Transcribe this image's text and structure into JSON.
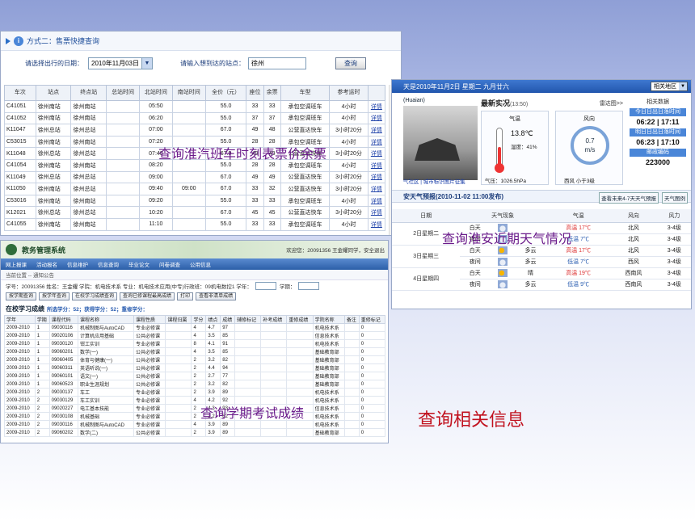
{
  "bus": {
    "header": "方式二：售票快捷查询",
    "date_label": "请选择出行的日期：",
    "date_value": "2010年11月03日",
    "station_label": "请输入想到达的站点：",
    "station_value": "徐州",
    "query_button": "查询",
    "columns": [
      "车次",
      "站点",
      "终点站",
      "总站时间",
      "北站时间",
      "南站时间",
      "全价（元）",
      "座位",
      "余票",
      "车型",
      "参考运时",
      ""
    ],
    "rows": [
      [
        "C41051",
        "徐州南站",
        "徐州南站",
        "",
        "05:50",
        "",
        "55.0",
        "33",
        "33",
        "承包空调班车",
        "4小时",
        "详情"
      ],
      [
        "C41052",
        "徐州南站",
        "徐州南站",
        "",
        "06:20",
        "",
        "55.0",
        "37",
        "37",
        "承包空调班车",
        "4小时",
        "详情"
      ],
      [
        "K11047",
        "徐州总站",
        "徐州总站",
        "",
        "07:00",
        "",
        "67.0",
        "49",
        "48",
        "公营直达快车",
        "3小时20分",
        "详情"
      ],
      [
        "C53015",
        "徐州南站",
        "徐州南站",
        "",
        "07:20",
        "",
        "55.0",
        "28",
        "28",
        "承包空调班车",
        "4小时",
        "详情"
      ],
      [
        "K11048",
        "徐州总站",
        "徐州总站",
        "",
        "07:40",
        "",
        "67.0",
        "49",
        "49",
        "公营直达快车",
        "3小时20分",
        "详情"
      ],
      [
        "C41054",
        "徐州南站",
        "徐州南站",
        "",
        "08:20",
        "",
        "55.0",
        "28",
        "28",
        "承包空调班车",
        "4小时",
        "详情"
      ],
      [
        "K11049",
        "徐州总站",
        "徐州总站",
        "",
        "09:00",
        "",
        "67.0",
        "49",
        "49",
        "公营直达快车",
        "3小时20分",
        "详情"
      ],
      [
        "K11050",
        "徐州南站",
        "徐州总站",
        "",
        "09:40",
        "09:00",
        "67.0",
        "33",
        "32",
        "公营直达快车",
        "3小时20分",
        "详情"
      ],
      [
        "C53016",
        "徐州南站",
        "徐州南站",
        "",
        "09:20",
        "",
        "55.0",
        "33",
        "33",
        "承包空调班车",
        "4小时",
        "详情"
      ],
      [
        "K12021",
        "徐州总站",
        "徐州总站",
        "",
        "10:20",
        "",
        "67.0",
        "45",
        "45",
        "公营直达快车",
        "3小时20分",
        "详情"
      ],
      [
        "C41055",
        "徐州南站",
        "徐州南站",
        "",
        "11:10",
        "",
        "55.0",
        "33",
        "33",
        "承包空调班车",
        "4小时",
        "详情"
      ]
    ]
  },
  "weather": {
    "date_bar": "天是2010年11月2日 星期二 九月廿六",
    "region_select": "相关地区",
    "city": "(Huaian)",
    "links": "气社区 | 城市标识图片征集",
    "now_title": "最新实况",
    "now_time": "(13:50)",
    "radar": "雷达图>>",
    "temp_label": "气温",
    "temp_value": "13.8℃",
    "humidity": "湿度：41%",
    "pressure": "气压：1026.5hPa",
    "wind_label": "风向",
    "wind_speed": "0.7",
    "wind_unit": "m/s",
    "wind_dir": "西风 小于3级",
    "rel_title": "相关数据",
    "sunrise_label": "今日日出日落时间",
    "sunrise": "06:22 | 17:11",
    "sunrise2_label": "明日日出日落时间",
    "sunrise2": "06:23 | 17:10",
    "zip_label": "邮政编码",
    "zip": "223000",
    "forecast_title": "安天气预报(2010-11-02 11:00发布)",
    "btn_more": "查看未来4-7天天气预报",
    "btn_map": "天气图例",
    "columns": [
      "日期",
      "天气现象",
      "气温",
      "风向",
      "风力"
    ],
    "rows": [
      {
        "day": "2日星期二",
        "part": "白天",
        "icon": "cloud",
        "phen": "",
        "temp": "高温 17℃",
        "tc": "hi",
        "wind": "北风",
        "force": "3-4级"
      },
      {
        "day": "",
        "part": "夜间",
        "icon": "cloud",
        "phen": "",
        "temp": "低温 7℃",
        "tc": "lo",
        "wind": "北风",
        "force": "3-4级"
      },
      {
        "day": "3日星期三",
        "part": "白天",
        "icon": "sun",
        "phen": "多云",
        "temp": "高温 17℃",
        "tc": "hi",
        "wind": "北风",
        "force": "3-4级"
      },
      {
        "day": "",
        "part": "夜间",
        "icon": "cloud",
        "phen": "多云",
        "temp": "低温 7℃",
        "tc": "lo",
        "wind": "西风",
        "force": "3-4级"
      },
      {
        "day": "4日星期四",
        "part": "白天",
        "icon": "sun",
        "phen": "晴",
        "temp": "高温 19℃",
        "tc": "hi",
        "wind": "西南风",
        "force": "3-4级"
      },
      {
        "day": "",
        "part": "夜间",
        "icon": "cloud",
        "phen": "多云",
        "temp": "低温 9℃",
        "tc": "lo",
        "wind": "西南风",
        "force": "3-4级"
      }
    ]
  },
  "edu": {
    "system_name": "教务管理系统",
    "user": "欢迎您：20091356 王金耀同学，安全退出",
    "menu": [
      "网上报课",
      "活动报名",
      "信息维护",
      "信息查询",
      "毕业论文",
      "问卷调查",
      "公用信息"
    ],
    "crumb": "当前位置 -- 通知公告",
    "filter": "学号：20091356 姓名：王金耀 学院：机电技术系 专业：机电技术应用(中专)行政班：09机电数控1 学年：",
    "term_label": "学期：",
    "actions": [
      "按学期查询",
      "按学年查询",
      "在校学习成绩查询",
      "查询已修课程最高成绩",
      "打印",
      "查看非清单成绩"
    ],
    "score_title": "在校学习成绩",
    "score_sub": "所选学分：52；获得学分：52；重修学分：",
    "columns": [
      "学年",
      "学期",
      "课程代码",
      "课程名称",
      "课程性质",
      "课程归属",
      "学分",
      "绩点",
      "成绩",
      "辅修标记",
      "补考成绩",
      "重修成绩",
      "学院名称",
      "备注",
      "重修标记"
    ],
    "rows": [
      [
        "2009-2010",
        "1",
        "09030116",
        "机械制图与AutoCAD",
        "专业必修课",
        "",
        "4",
        "4.7",
        "97",
        "",
        "",
        "",
        "机电技术系",
        "",
        "0"
      ],
      [
        "2009-2010",
        "1",
        "09020106",
        "计算机应用基础",
        "公共必修课",
        "",
        "4",
        "3.5",
        "85",
        "",
        "",
        "",
        "信息技术系",
        "",
        "0"
      ],
      [
        "2009-2010",
        "1",
        "09030120",
        "钳工实训",
        "专业必修课",
        "",
        "8",
        "4.1",
        "91",
        "",
        "",
        "",
        "机电技术系",
        "",
        "0"
      ],
      [
        "2009-2010",
        "1",
        "09060201",
        "数学(一)",
        "公共必修课",
        "",
        "4",
        "3.5",
        "85",
        "",
        "",
        "",
        "基础教育部",
        "",
        "0"
      ],
      [
        "2009-2010",
        "1",
        "09060405",
        "体育与健康(一)",
        "公共必修课",
        "",
        "2",
        "3.2",
        "82",
        "",
        "",
        "",
        "基础教育部",
        "",
        "0"
      ],
      [
        "2009-2010",
        "1",
        "09060311",
        "英语听说(一)",
        "公共必修课",
        "",
        "2",
        "4.4",
        "94",
        "",
        "",
        "",
        "基础教育部",
        "",
        "0"
      ],
      [
        "2009-2010",
        "1",
        "09060101",
        "语文(一)",
        "公共必修课",
        "",
        "2",
        "2.7",
        "77",
        "",
        "",
        "",
        "基础教育部",
        "",
        "0"
      ],
      [
        "2009-2010",
        "1",
        "09060523",
        "职业生涯规划",
        "公共必修课",
        "",
        "2",
        "3.2",
        "82",
        "",
        "",
        "",
        "基础教育部",
        "",
        "0"
      ],
      [
        "2009-2010",
        "2",
        "09030137",
        "车工",
        "专业必修课",
        "",
        "2",
        "3.9",
        "89",
        "",
        "",
        "",
        "机电技术系",
        "",
        "0"
      ],
      [
        "2009-2010",
        "2",
        "09030129",
        "车工实训",
        "专业必修课",
        "",
        "4",
        "4.2",
        "92",
        "",
        "",
        "",
        "机电技术系",
        "",
        "0"
      ],
      [
        "2009-2010",
        "2",
        "09020227",
        "电工基本技能",
        "专业必修课",
        "",
        "2",
        "4.3",
        "93",
        "",
        "",
        "",
        "信息技术系",
        "",
        "0"
      ],
      [
        "2009-2010",
        "2",
        "09030108",
        "机械基础",
        "专业必修课",
        "",
        "2",
        "3.2",
        "82",
        "",
        "",
        "",
        "机电技术系",
        "",
        "0"
      ],
      [
        "2009-2010",
        "2",
        "09030116",
        "机械制图与AutoCAD",
        "专业必修课",
        "",
        "4",
        "3.9",
        "89",
        "",
        "",
        "",
        "机电技术系",
        "",
        "0"
      ],
      [
        "2009-2010",
        "2",
        "09060202",
        "数学(二)",
        "公共必修课",
        "",
        "2",
        "3.9",
        "89",
        "",
        "",
        "",
        "基础教育部",
        "",
        "0"
      ]
    ]
  },
  "overlays": {
    "bus": "查询淮汽班车时刻表票价余票",
    "weather": "查询淮安近期天气情况",
    "exam": "查询学期考试成绩",
    "info": "查询相关信息"
  }
}
